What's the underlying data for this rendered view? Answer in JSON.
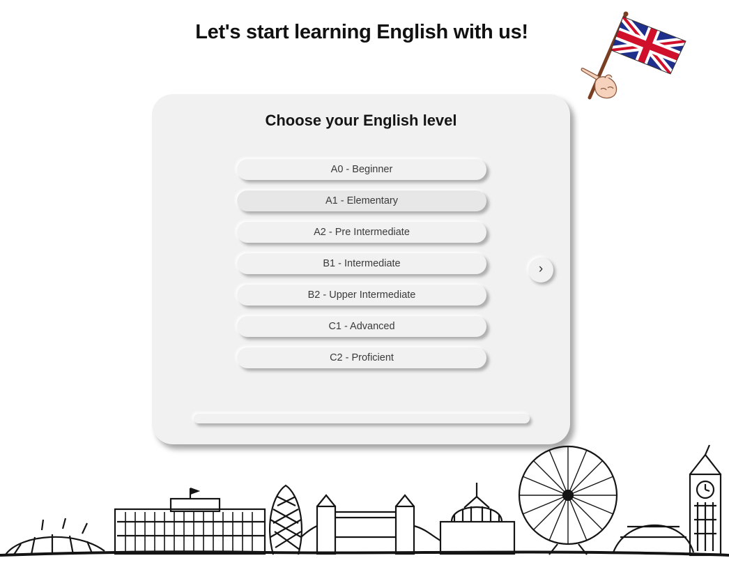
{
  "header": {
    "title": "Let's start learning English with us!",
    "flag_icon": "union-jack-flag-with-pointing-hand"
  },
  "card": {
    "title": "Choose your English level",
    "levels": [
      {
        "label": "A0 - Beginner"
      },
      {
        "label": "A1 - Elementary"
      },
      {
        "label": "A2 - Pre Intermediate"
      },
      {
        "label": "B1 - Intermediate"
      },
      {
        "label": "B2 - Upper Intermediate"
      },
      {
        "label": "C1 - Advanced"
      },
      {
        "label": "C2 - Proficient"
      }
    ],
    "selected_index": 1,
    "next_label": "›",
    "progress_percent": 0
  },
  "footer": {
    "illustration": "london-skyline-sketch"
  },
  "colors": {
    "background": "#ffffff",
    "card": "#f1f1f1",
    "selected_option": "#e7e7e7",
    "text": "#151515",
    "flag_blue": "#1f2f8c",
    "flag_red": "#d0102a"
  }
}
